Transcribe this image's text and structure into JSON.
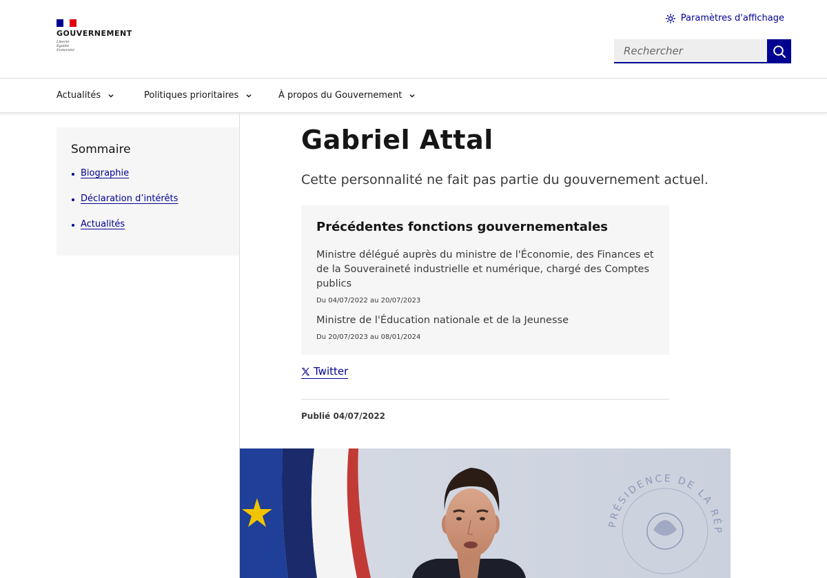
{
  "header": {
    "logo_text": "GOUVERNEMENT",
    "motto": [
      "Liberté",
      "Égalité",
      "Fraternité"
    ],
    "display_settings_label": "Paramètres d'affichage",
    "search_placeholder": "Rechercher"
  },
  "nav": {
    "items": [
      {
        "label": "Actualités"
      },
      {
        "label": "Politiques prioritaires"
      },
      {
        "label": "À propos du Gouvernement"
      }
    ]
  },
  "sidebar": {
    "title": "Sommaire",
    "links": [
      {
        "label": "Biographie"
      },
      {
        "label": "Déclaration d’intérêts"
      },
      {
        "label": "Actualités"
      }
    ]
  },
  "main": {
    "name": "Gabriel Attal",
    "subtitle": "Cette personnalité ne fait pas partie du gouvernement actuel.",
    "functions": {
      "title": "Précédentes fonctions gouvernementales",
      "items": [
        {
          "title": "Ministre délégué auprès du ministre de l'Économie, des Finances et de la Souveraineté industrielle et numérique, chargé des Comptes publics",
          "dates": "Du 04/07/2022 au 20/07/2023"
        },
        {
          "title": "Ministre de l'Éducation nationale et de la Jeunesse",
          "dates": "Du 20/07/2023 au 08/01/2024"
        }
      ]
    },
    "twitter_label": "Twitter",
    "published": "Publié 04/07/2022"
  },
  "photo": {
    "seal_text": "PRÉSIDENCE DE LA RÉPUBLIQUE"
  },
  "colors": {
    "accent": "#000091",
    "panel_bg": "#f6f6f6",
    "flag_red": "#e1000f"
  }
}
